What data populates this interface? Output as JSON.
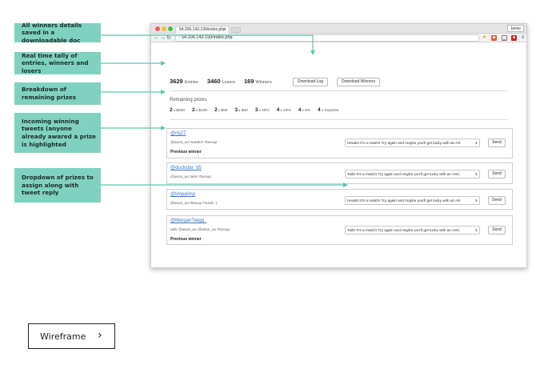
{
  "annotations": [
    "All winners details saved in a downloadable doc",
    "Real time tally of entries, winners and losers",
    "Breakdown of remaining prizes",
    "Incoming winning tweets (anyone already awared a prize is highlighted",
    "Dropdown of prizes to assign along with tweet reply"
  ],
  "browser": {
    "tab_title": "54.206.143.199/index.php",
    "user": "Jamie",
    "url": "54.206.143.199/index.php"
  },
  "stats": {
    "entries": {
      "value": "3629",
      "label": "Entries"
    },
    "losers": {
      "value": "3460",
      "label": "Losers"
    },
    "winners": {
      "value": "169",
      "label": "Winners"
    }
  },
  "buttons": {
    "download_log": "Download Log",
    "download_winners": "Download Winners"
  },
  "remaining": {
    "title": "Remaining prizes",
    "prizes": [
      {
        "count": "2",
        "label": "x $500"
      },
      {
        "count": "2",
        "label": "x $100"
      },
      {
        "count": "2",
        "label": "x $50"
      },
      {
        "count": "3",
        "label": "x $20"
      },
      {
        "count": "3",
        "label": "x 20%"
      },
      {
        "count": "4",
        "label": "x 10%"
      },
      {
        "count": "4",
        "label": "x 5%"
      },
      {
        "count": "4",
        "label": "x Surprise"
      }
    ]
  },
  "tweets": [
    {
      "handle": "@rrjj27",
      "text": "@asos_au heads!!! #twoup",
      "previous": "Previous winner",
      "prize": "Heads! It's a match! Try again and maybe you'll get lucky with an AS",
      "send": "Send"
    },
    {
      "handle": "@duckstar_85",
      "text": "@asos_au tails! #twoup",
      "previous": "",
      "prize": "Tails! It's a match! Try again and maybe you'll get lucky with an ASC",
      "send": "Send"
    },
    {
      "handle": "@limpylimp",
      "text": "@asos_au #twoup heads :)",
      "previous": "",
      "prize": "Heads! It's a match! Try again and maybe you'll get lucky with an AS",
      "send": "Send"
    },
    {
      "handle": "@MorganTwigg_",
      "text": "tails @asos_au @asos_au #twoup",
      "previous": "Previous winner",
      "prize": "Tails! It's a match! Try again and maybe you'll get lucky with an ASC",
      "send": "Send"
    }
  ],
  "wireframe": {
    "label": "Wireframe",
    "chevron": "›"
  }
}
